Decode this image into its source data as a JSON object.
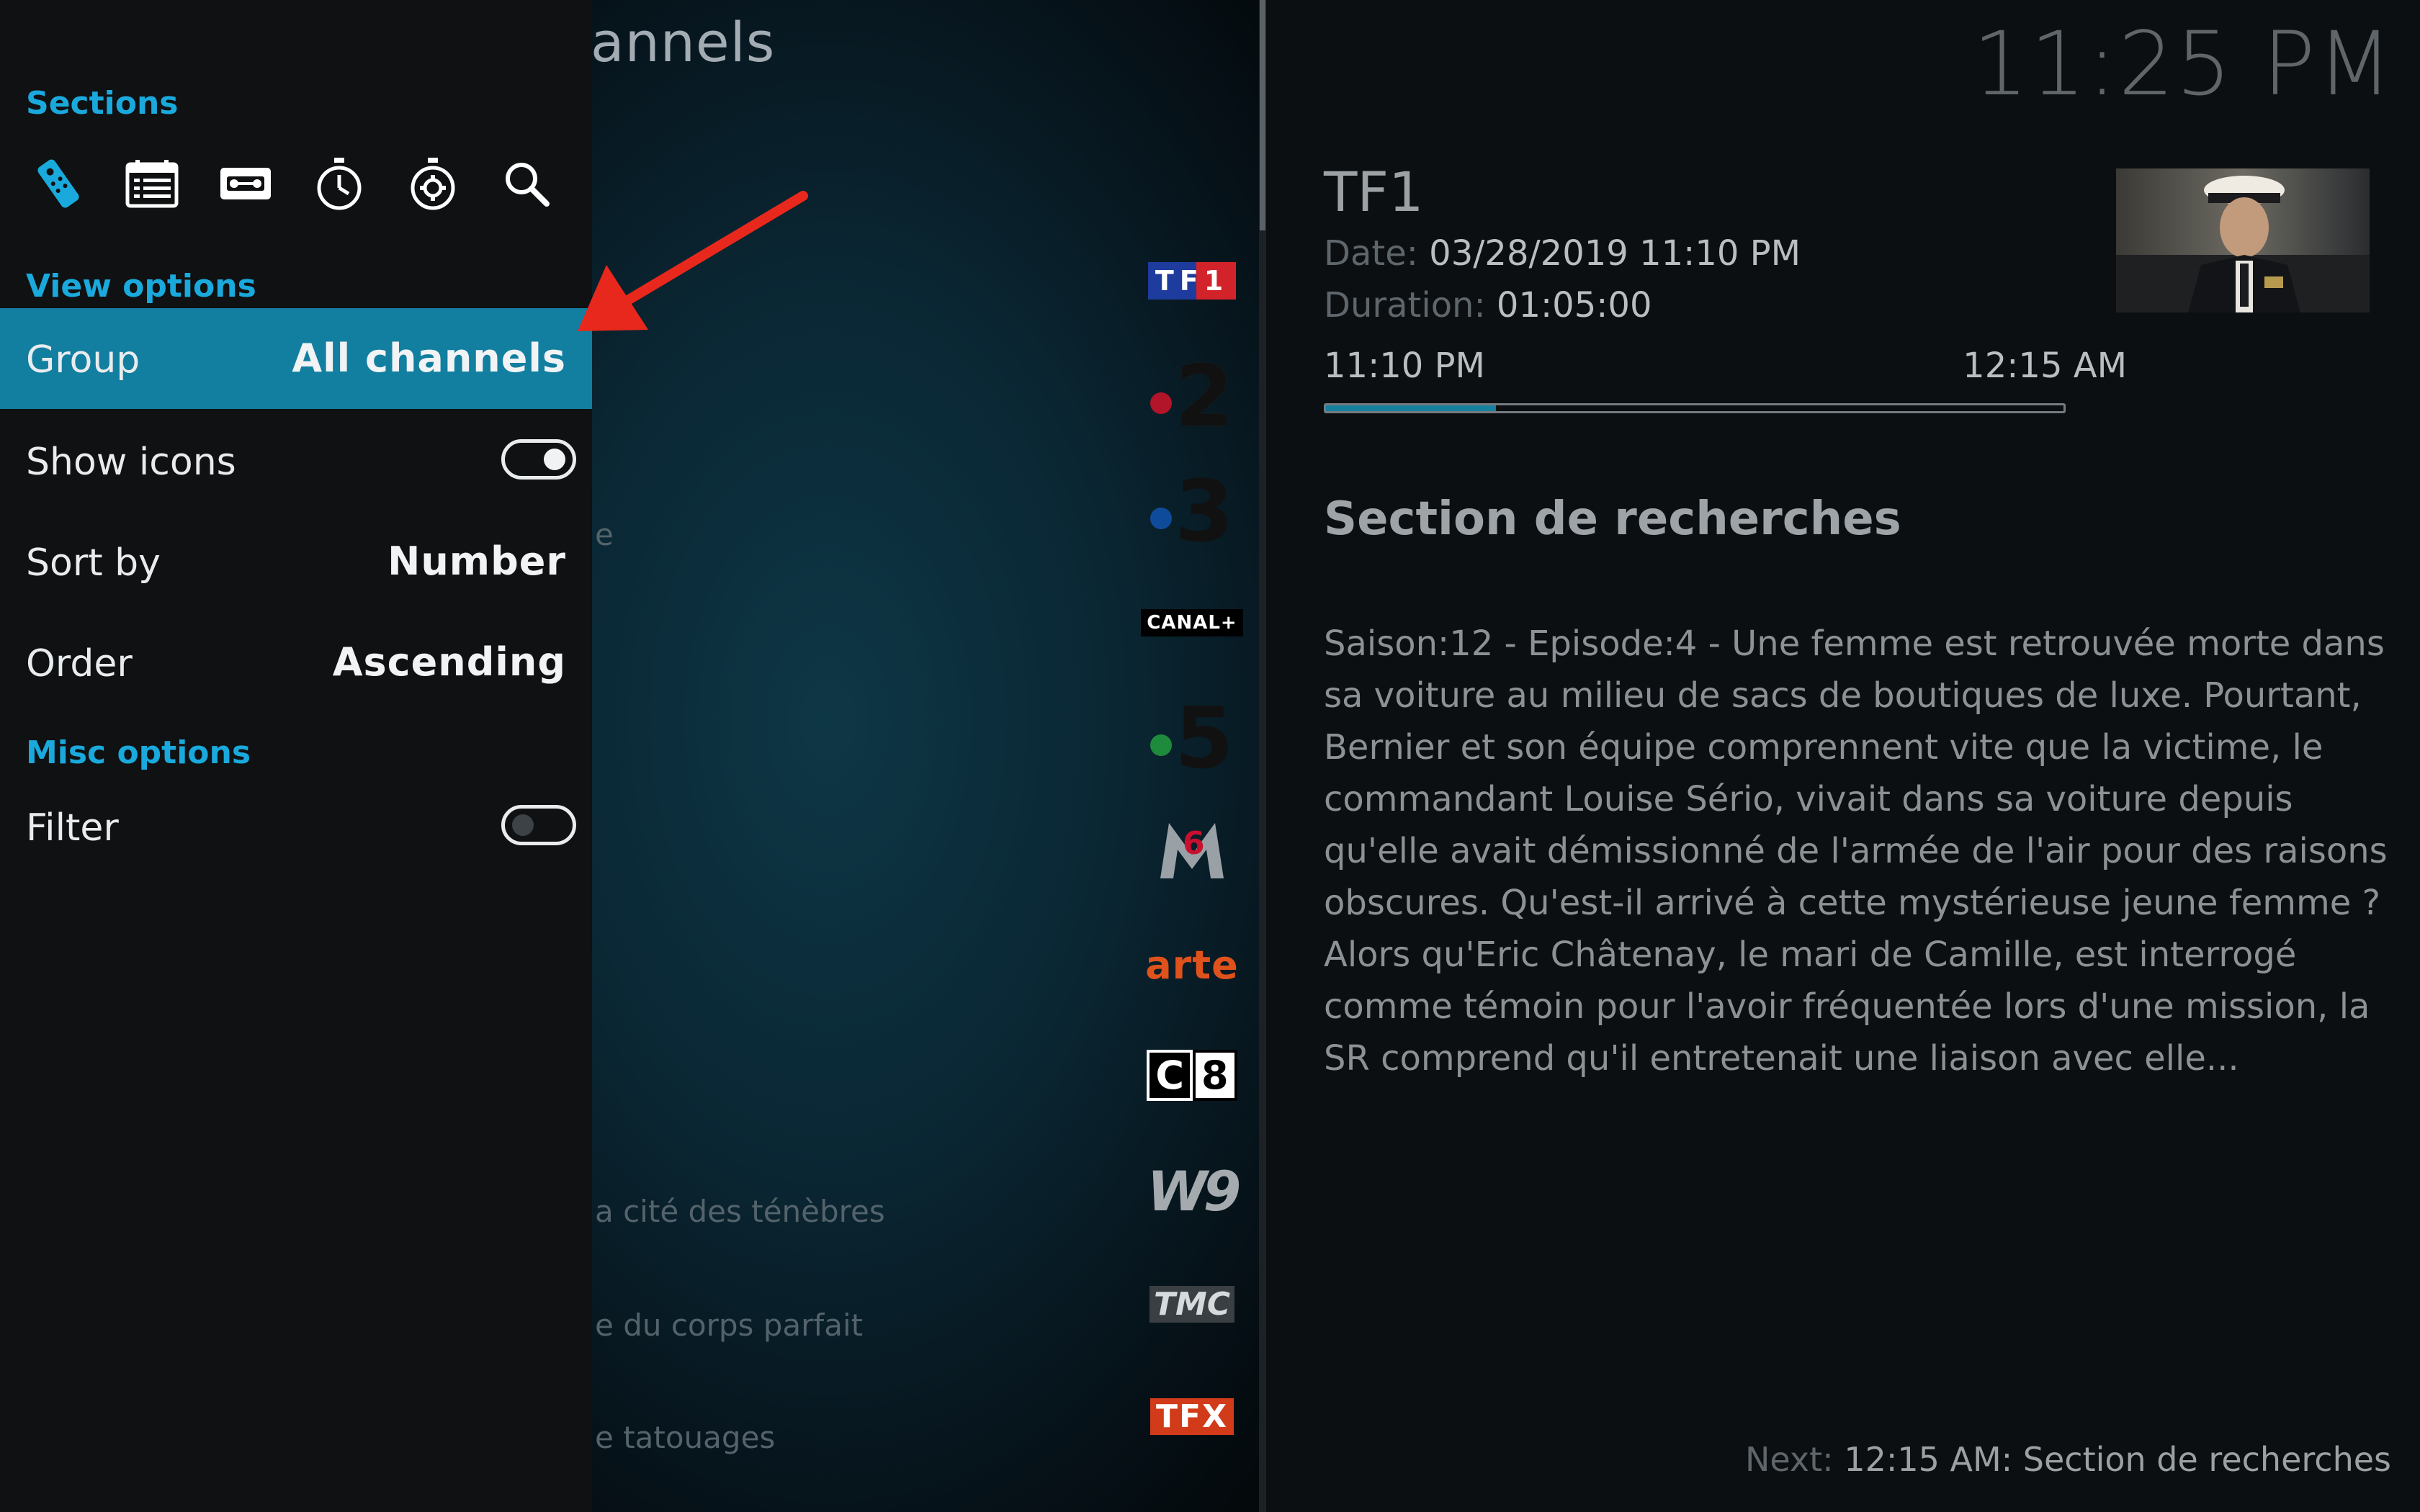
{
  "channel_list": {
    "title_fragment": "annels",
    "channels": [
      {
        "name": "TF1",
        "program": ""
      },
      {
        "name": "France 2",
        "program": ""
      },
      {
        "name": "France 3",
        "program": "e"
      },
      {
        "name": "CANAL+",
        "program": ""
      },
      {
        "name": "France 5",
        "program": ""
      },
      {
        "name": "M6",
        "program": ""
      },
      {
        "name": "arte",
        "program": ""
      },
      {
        "name": "C8",
        "program": ""
      },
      {
        "name": "W9",
        "program": "a cité des ténèbres"
      },
      {
        "name": "TMC",
        "program": "e du corps parfait"
      },
      {
        "name": "TFX",
        "program": "e tatouages"
      }
    ],
    "logo_text": {
      "tf1": "TF1",
      "f2": "2",
      "f3": "3",
      "canal": "CANAL+",
      "f5": "5",
      "m6": "6",
      "arte": "arte",
      "c8_c": "C",
      "c8_8": "8",
      "w9": "W9",
      "tmc": "TMC",
      "tfx": "TFX"
    }
  },
  "sidebar": {
    "sections_heading": "Sections",
    "section_icons": [
      "remote-icon",
      "guide-icon",
      "recordings-icon",
      "timers-icon",
      "timer-rules-icon",
      "search-icon"
    ],
    "view_options_heading": "View options",
    "group": {
      "label": "Group",
      "value": "All channels"
    },
    "show_icons": {
      "label": "Show icons",
      "enabled": true
    },
    "sort_by": {
      "label": "Sort by",
      "value": "Number"
    },
    "order": {
      "label": "Order",
      "value": "Ascending"
    },
    "misc_options_heading": "Misc options",
    "filter": {
      "label": "Filter",
      "enabled": false
    }
  },
  "info": {
    "clock": "11:25 PM",
    "channel_name": "TF1",
    "date_label": "Date:",
    "date_value": "03/28/2019 11:10 PM",
    "duration_label": "Duration:",
    "duration_value": "01:05:00",
    "start_time": "11:10 PM",
    "end_time": "12:15 AM",
    "progress_fraction": 0.23,
    "episode_title": "Section de recherches",
    "plot": "Saison:12 - Episode:4 - Une femme est retrouvée morte dans sa voiture au milieu de sacs de boutiques de luxe. Pourtant, Bernier et son équipe comprennent vite que la victime, le commandant Louise Sério, vivait dans sa voiture depuis qu'elle avait démissionné de l'armée de l'air pour des raisons obscures. Qu'est-il arrivé à cette mystérieuse jeune femme ? Alors qu'Eric Châtenay, le mari de Camille, est interrogé comme témoin pour l'avoir fréquentée lors d'une mission, la SR comprend qu'il entretenait une liaison avec elle...",
    "next_label": "Next:",
    "next_value": "12:15 AM: Section de recherches"
  },
  "colors": {
    "accent": "#127fa0",
    "heading": "#1aa9dc",
    "annotation_arrow": "#e8281c"
  }
}
